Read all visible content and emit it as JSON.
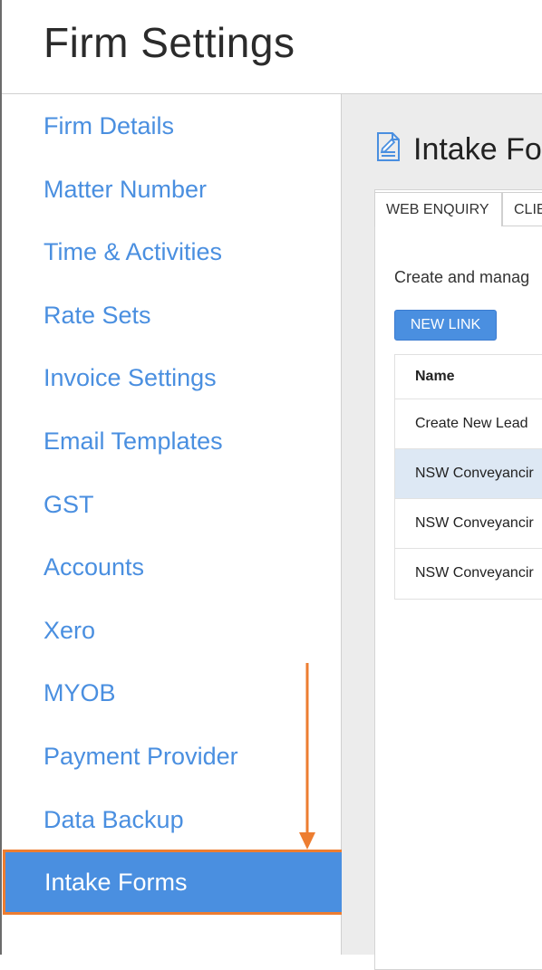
{
  "page": {
    "title": "Firm Settings"
  },
  "sidebar": {
    "items": [
      {
        "label": "Firm Details"
      },
      {
        "label": "Matter Number"
      },
      {
        "label": "Time & Activities"
      },
      {
        "label": "Rate Sets"
      },
      {
        "label": "Invoice Settings"
      },
      {
        "label": "Email Templates"
      },
      {
        "label": "GST"
      },
      {
        "label": "Accounts"
      },
      {
        "label": "Xero"
      },
      {
        "label": "MYOB"
      },
      {
        "label": "Payment Provider"
      },
      {
        "label": "Data Backup"
      },
      {
        "label": "Intake Forms",
        "active": true
      }
    ]
  },
  "content": {
    "section_title": "Intake Fo",
    "tabs": [
      {
        "label": "WEB ENQUIRY",
        "active": true
      },
      {
        "label": "CLIE"
      }
    ],
    "description": "Create and manag",
    "new_link_label": "NEW LINK",
    "table": {
      "header": "Name",
      "rows": [
        {
          "name": "Create New Lead"
        },
        {
          "name": "NSW Conveyancir",
          "selected": true
        },
        {
          "name": "NSW Conveyancir"
        },
        {
          "name": "NSW Conveyancir"
        }
      ]
    }
  },
  "colors": {
    "accent": "#4a8fe0",
    "annotation": "#ed7d31",
    "selected_row": "#dde8f4"
  },
  "icons": {
    "section_icon": "document-edit-icon",
    "annotation_arrow": "arrow-down-icon"
  }
}
